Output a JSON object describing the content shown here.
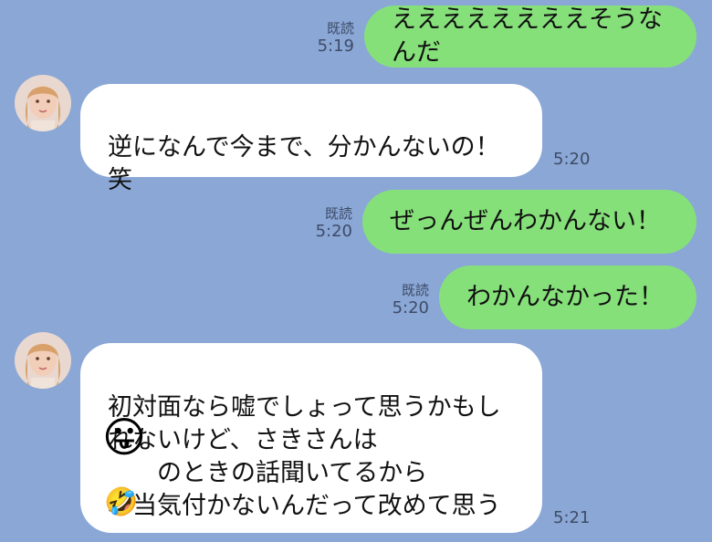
{
  "messages": [
    {
      "dir": "out",
      "read": "既読",
      "time": "5:19",
      "text": "ええええええええそうなんだ"
    },
    {
      "dir": "in",
      "time": "5:20",
      "text": "逆になんで今まで、分かんないの！\n笑"
    },
    {
      "dir": "out",
      "read": "既読",
      "time": "5:20",
      "text": "ぜっんぜんわかんない！"
    },
    {
      "dir": "out",
      "read": "既読",
      "time": "5:20",
      "text": "わかんなかった！"
    },
    {
      "dir": "in",
      "time": "5:21",
      "text": "初対面なら嘘でしょって思うかもし\nれないけど、さきさんは\n　　のときの話聞いてるから\n本当気付かないんだって改めて思う",
      "emoji_overlay": "😛",
      "emoji_end": "🤣"
    }
  ],
  "colors": {
    "background": "#8aa7d6",
    "outgoing": "#86e07a",
    "incoming": "#ffffff"
  }
}
